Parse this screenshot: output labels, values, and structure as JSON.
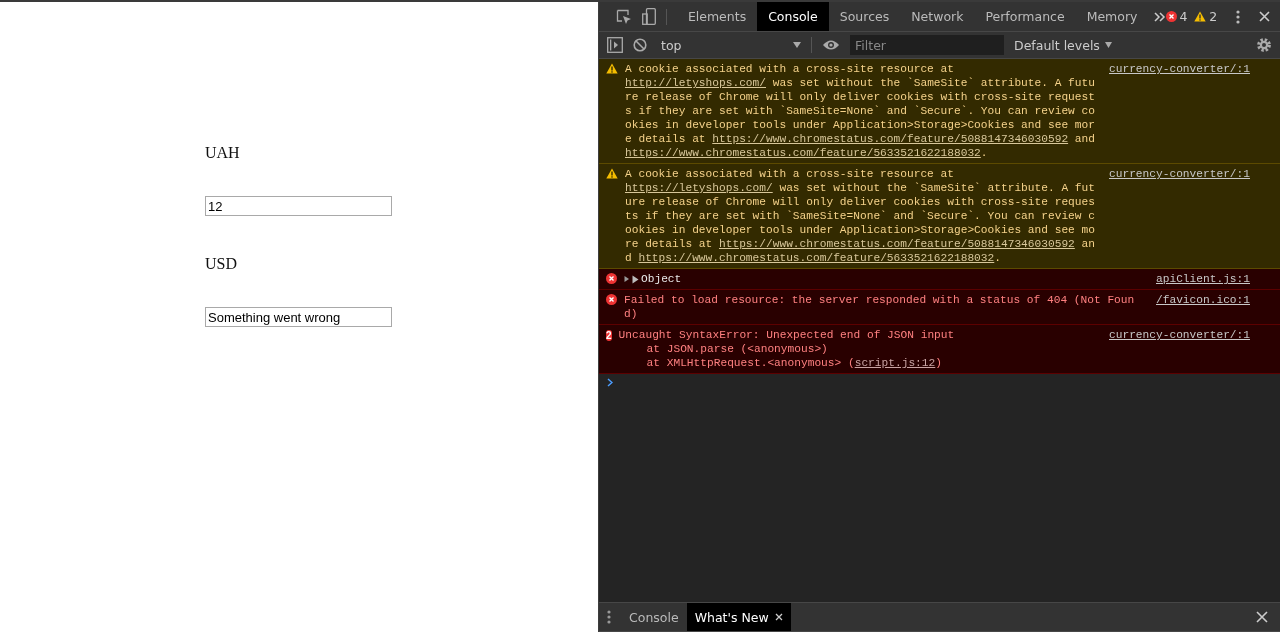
{
  "page": {
    "fields": [
      {
        "label": "UAH",
        "value": "12"
      },
      {
        "label": "USD",
        "value": "Something went wrong"
      }
    ]
  },
  "devtools": {
    "tabs": [
      {
        "label": "Elements",
        "selected": false
      },
      {
        "label": "Console",
        "selected": true
      },
      {
        "label": "Sources",
        "selected": false
      },
      {
        "label": "Network",
        "selected": false
      },
      {
        "label": "Performance",
        "selected": false
      },
      {
        "label": "Memory",
        "selected": false
      }
    ],
    "error_count": "4",
    "warning_count": "2",
    "toolbar": {
      "context": "top",
      "filter_placeholder": "Filter",
      "levels": "Default levels"
    },
    "messages": [
      {
        "kind": "warning",
        "expandable": false,
        "source": "currency-converter/:1",
        "parts": [
          {
            "kind": "text",
            "text": "A cookie associated with a cross-site resource at "
          },
          {
            "kind": "link",
            "text": "http://letyshops.com/"
          },
          {
            "kind": "text",
            "text": " was set without the `SameSite` attribute. A future release of Chrome will only deliver cookies with cross-site requests if they are set with `SameSite=None` and `Secure`. You can review cookies in developer tools under Application>Storage>Cookies and see more details at "
          },
          {
            "kind": "link",
            "text": "https://www.chromestatus.com/feature/5088147346030592"
          },
          {
            "kind": "text",
            "text": " and "
          },
          {
            "kind": "link",
            "text": "https://www.chromestatus.com/feature/5633521622188032"
          },
          {
            "kind": "text",
            "text": "."
          }
        ]
      },
      {
        "kind": "warning",
        "expandable": false,
        "source": "currency-converter/:1",
        "parts": [
          {
            "kind": "text",
            "text": "A cookie associated with a cross-site resource at "
          },
          {
            "kind": "link",
            "text": "https://letyshops.com/"
          },
          {
            "kind": "text",
            "text": " was set without the `SameSite` attribute. A future release of Chrome will only deliver cookies with cross-site requests if they are set with `SameSite=None` and `Secure`. You can review cookies in developer tools under Application>Storage>Cookies and see more details at "
          },
          {
            "kind": "link",
            "text": "https://www.chromestatus.com/feature/5088147346030592"
          },
          {
            "kind": "text",
            "text": " and "
          },
          {
            "kind": "link",
            "text": "https://www.chromestatus.com/feature/5633521622188032"
          },
          {
            "kind": "text",
            "text": "."
          }
        ]
      },
      {
        "kind": "error",
        "expandable": true,
        "source": "apiClient.js:1",
        "parts": [
          {
            "kind": "text",
            "text": "Object"
          }
        ]
      },
      {
        "kind": "error",
        "expandable": false,
        "source": "/favicon.ico:1",
        "parts": [
          {
            "kind": "text",
            "text": "Failed to load resource: the server responded with a status of 404 (Not Found)"
          }
        ]
      },
      {
        "kind": "error",
        "expandable": false,
        "count": "2",
        "source": "currency-converter/:1",
        "parts": [
          {
            "kind": "text",
            "text": "Uncaught SyntaxError: Unexpected end of JSON input"
          }
        ],
        "stack": [
          [
            {
              "kind": "text",
              "text": "at JSON.parse (<anonymous>)"
            }
          ],
          [
            {
              "kind": "text",
              "text": "at XMLHttpRequest.<anonymous> ("
            },
            {
              "kind": "link",
              "text": "script.js:12"
            },
            {
              "kind": "text",
              "text": ")"
            }
          ]
        ]
      }
    ],
    "drawer_tabs": [
      {
        "label": "Console",
        "selected": false,
        "closable": false
      },
      {
        "label": "What's New",
        "selected": true,
        "closable": true
      }
    ]
  }
}
